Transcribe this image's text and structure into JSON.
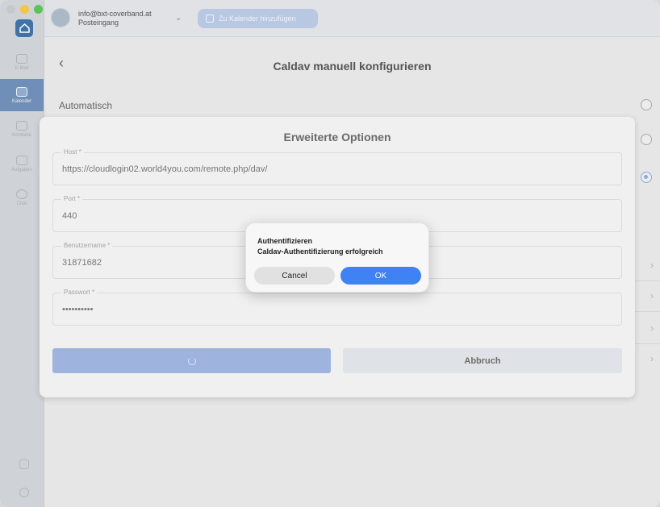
{
  "account": {
    "email": "info@bxt-coverband.at",
    "folder": "Posteingang"
  },
  "toolbar": {
    "add_calendar_label": "Zu Kalender hinzufügen"
  },
  "sidebar": {
    "items": [
      {
        "label": "E-Mail"
      },
      {
        "label": "Kalender"
      },
      {
        "label": "Kontakte"
      },
      {
        "label": "Aufgaben"
      },
      {
        "label": "Chat"
      }
    ]
  },
  "page": {
    "title": "Caldav manuell konfigurieren",
    "automatic_label": "Automatisch"
  },
  "advanced": {
    "title": "Erweiterte Optionen",
    "host_label": "Host *",
    "host_value": "https://cloudlogin02.world4you.com/remote.php/dav/",
    "port_label": "Port *",
    "port_value": "440",
    "user_label": "Benutzername *",
    "user_value": "31871682",
    "password_label": "Passwort *",
    "password_value": "••••••••••",
    "cancel_label": "Abbruch"
  },
  "alert": {
    "title": "Authentifizieren",
    "message": "Caldav-Authentifizierung erfolgreich",
    "cancel_label": "Cancel",
    "ok_label": "OK"
  },
  "colors": {
    "accent": "#3f82f3",
    "sidebar_active": "#6f8fb8",
    "primary_button_disabled": "#9eb4df"
  }
}
